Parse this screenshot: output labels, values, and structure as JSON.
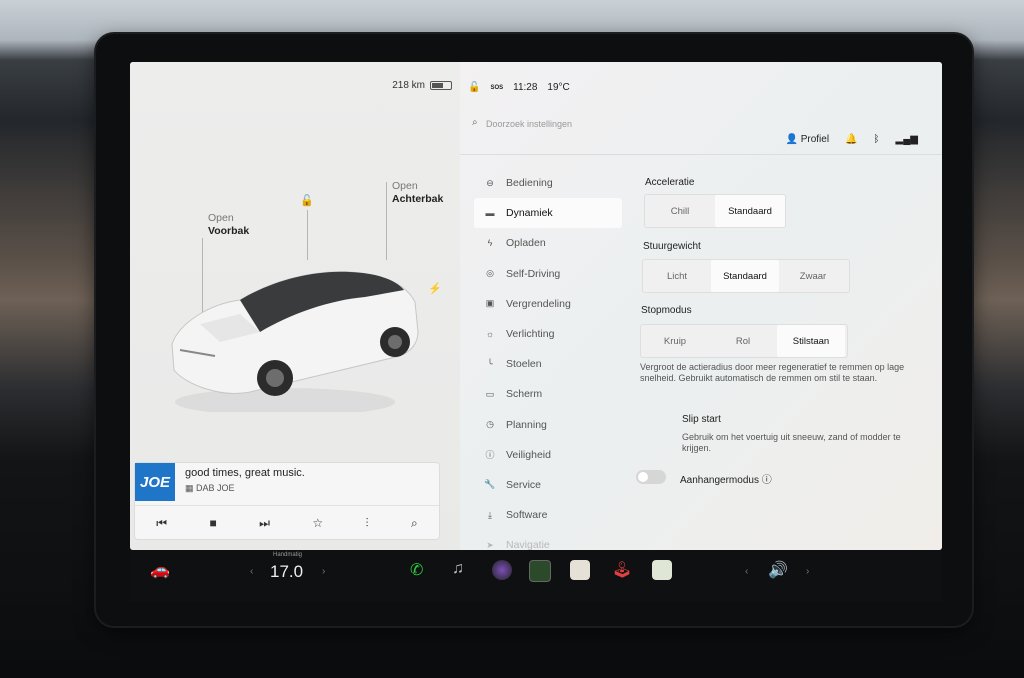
{
  "left_panel": {
    "range": "218 km",
    "frunk": {
      "action": "Open",
      "name": "Voorbak"
    },
    "trunk": {
      "action": "Open",
      "name": "Achterbak"
    },
    "media": {
      "logo_text": "JOE",
      "song": "good times, great music.",
      "station": "DAB JOE",
      "controls": [
        "prev-icon",
        "stop-icon",
        "next-icon",
        "favorite-icon",
        "equalizer-icon",
        "search-icon"
      ]
    }
  },
  "status_bar": {
    "time": "11:28",
    "temperature": "19°C",
    "sos": "SOS"
  },
  "header": {
    "search_placeholder": "Doorzoek instellingen",
    "profile": "Profiel"
  },
  "nav": {
    "items": [
      {
        "label": "Bediening",
        "icon": "toggle-icon"
      },
      {
        "label": "Dynamiek",
        "icon": "car-icon",
        "active": true
      },
      {
        "label": "Opladen",
        "icon": "bolt-icon"
      },
      {
        "label": "Self-Driving",
        "icon": "steering-wheel-icon"
      },
      {
        "label": "Vergrendeling",
        "icon": "lock-icon"
      },
      {
        "label": "Verlichting",
        "icon": "sun-icon"
      },
      {
        "label": "Stoelen",
        "icon": "seat-icon"
      },
      {
        "label": "Scherm",
        "icon": "display-icon"
      },
      {
        "label": "Planning",
        "icon": "clock-icon"
      },
      {
        "label": "Veiligheid",
        "icon": "info-icon"
      },
      {
        "label": "Service",
        "icon": "wrench-icon"
      },
      {
        "label": "Software",
        "icon": "download-icon"
      },
      {
        "label": "Navigatie",
        "icon": "navigation-icon"
      }
    ]
  },
  "settings": {
    "acceleration": {
      "title": "Acceleratie",
      "options": [
        "Chill",
        "Standaard"
      ],
      "selected": "Standaard"
    },
    "steering": {
      "title": "Stuurgewicht",
      "options": [
        "Licht",
        "Standaard",
        "Zwaar"
      ],
      "selected": "Standaard"
    },
    "stop_mode": {
      "title": "Stopmodus",
      "options": [
        "Kruip",
        "Rol",
        "Stilstaan"
      ],
      "selected": "Stilstaan"
    },
    "stop_desc": "Vergroot de actieradius door meer regeneratief te remmen op lage snelheid. Gebruikt automatisch de remmen om stil te staan.",
    "slip_start": {
      "title": "Slip start",
      "desc": "Gebruik om het voertuig uit sneeuw, zand of modder te krijgen."
    },
    "trailer": {
      "label": "Aanhangermodus",
      "on": false
    }
  },
  "dock": {
    "temp_mode": "Handmatig",
    "temperature": "17.0"
  }
}
